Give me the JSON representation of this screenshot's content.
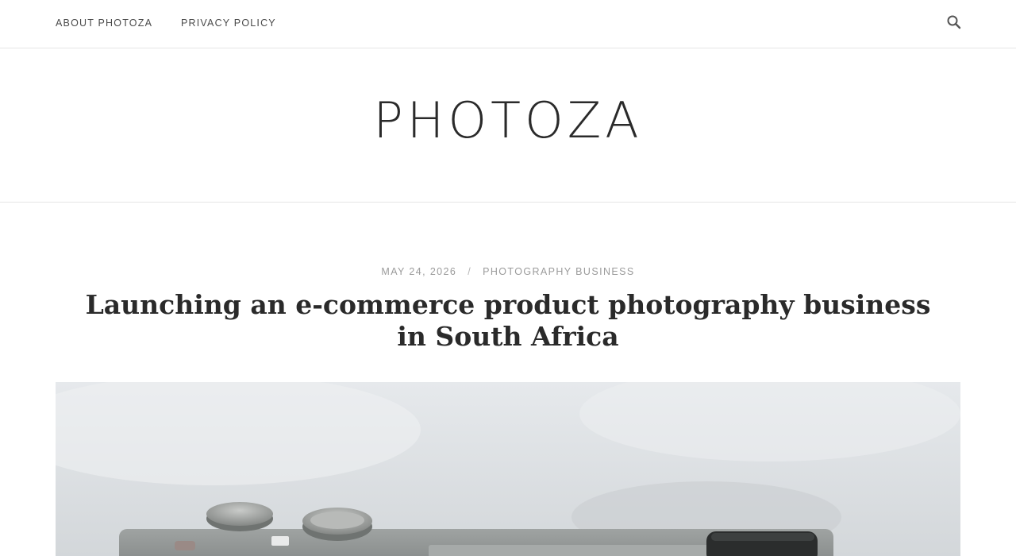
{
  "nav": {
    "items": [
      {
        "label": "ABOUT PHOTOZA"
      },
      {
        "label": "PRIVACY POLICY"
      }
    ],
    "search_icon": "search-icon"
  },
  "site": {
    "title": "PHOTOZA"
  },
  "post": {
    "date": "MAY 24, 2026",
    "separator": "/",
    "category": "PHOTOGRAPHY BUSINESS",
    "title": "Launching an e-commerce product photography business in South Africa",
    "featured_image": "camera-photo"
  },
  "colors": {
    "text_dark": "#2a2a2a",
    "meta_gray": "#9b9b9b",
    "divider": "#e6e6e6"
  }
}
